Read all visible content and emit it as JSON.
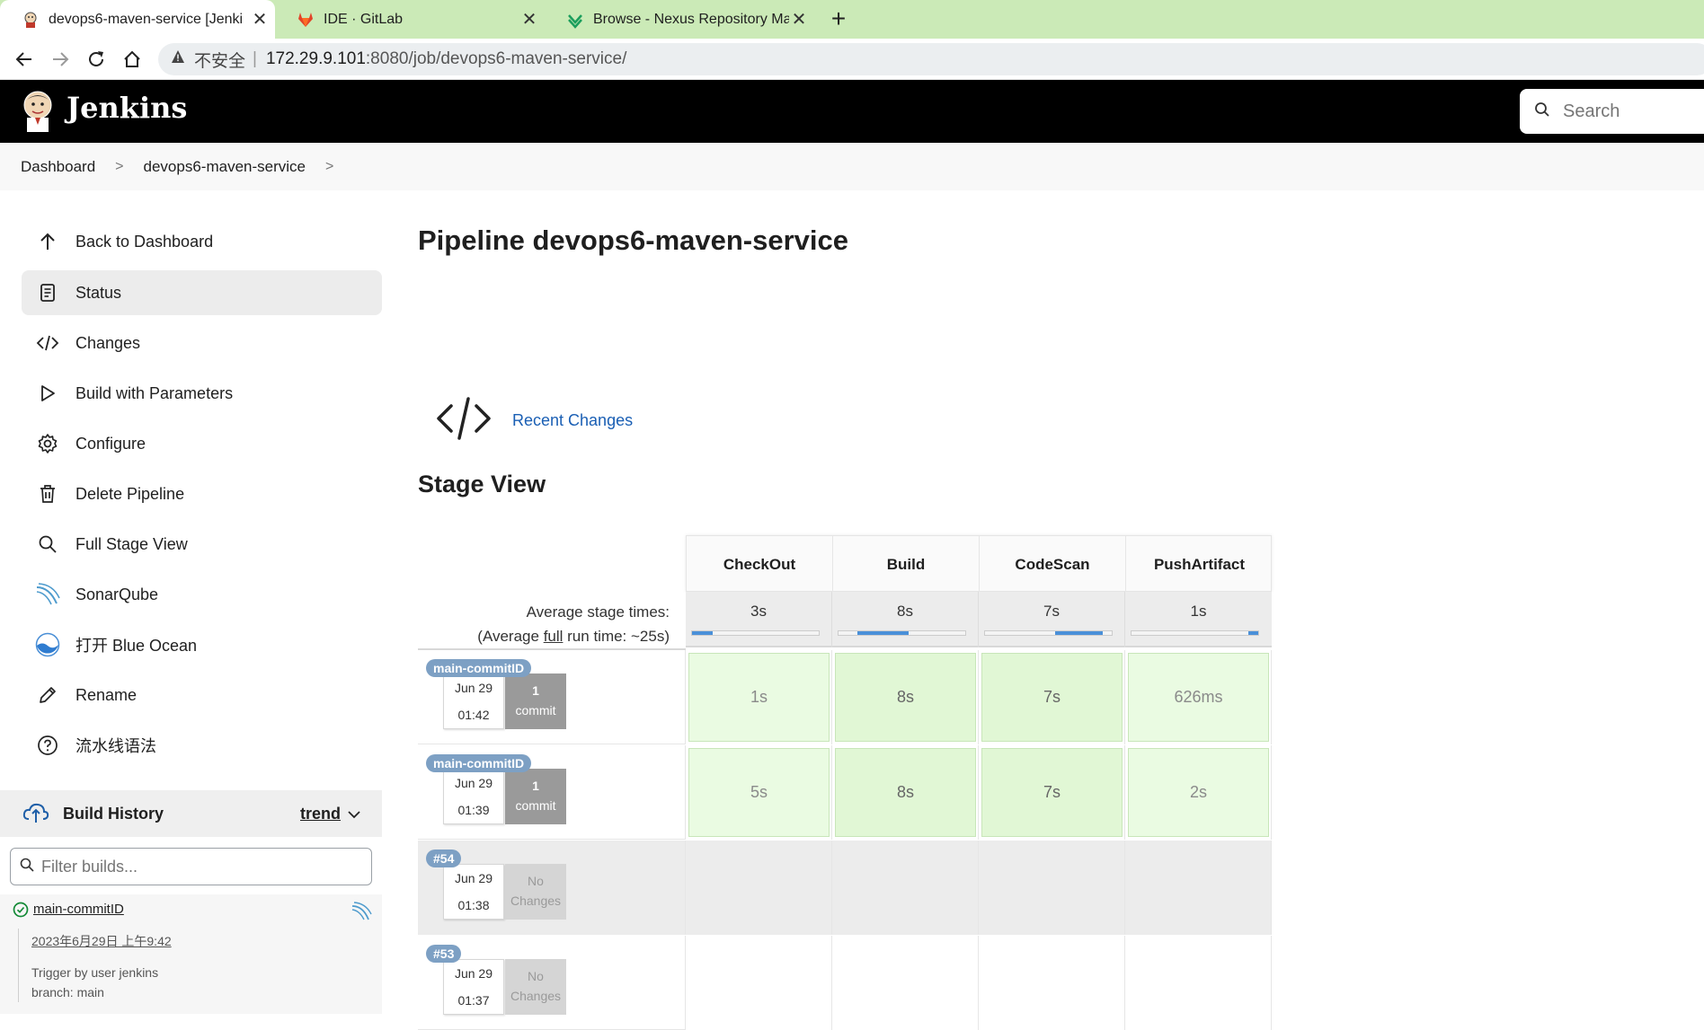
{
  "browser": {
    "tabs": [
      {
        "title": "devops6-maven-service [Jenki",
        "favicon": "jenkins-icon",
        "active": true
      },
      {
        "title": "IDE · GitLab",
        "favicon": "gitlab-icon",
        "active": false
      },
      {
        "title": "Browse - Nexus Repository Ma",
        "favicon": "nexus-icon",
        "active": false
      }
    ],
    "new_tab": "+",
    "address": {
      "insecure_label": "不安全",
      "separator": "|",
      "host": "172.29.9.101",
      "path": ":8080/job/devops6-maven-service/"
    }
  },
  "header": {
    "app_name": "Jenkins",
    "search_placeholder": "Search"
  },
  "breadcrumb": [
    "Dashboard",
    "devops6-maven-service"
  ],
  "sidebar": {
    "items": [
      {
        "label": "Back to Dashboard",
        "icon": "arrow-up-icon"
      },
      {
        "label": "Status",
        "icon": "document-icon",
        "active": true
      },
      {
        "label": "Changes",
        "icon": "code-icon"
      },
      {
        "label": "Build with Parameters",
        "icon": "play-icon"
      },
      {
        "label": "Configure",
        "icon": "gear-icon"
      },
      {
        "label": "Delete Pipeline",
        "icon": "trash-icon"
      },
      {
        "label": "Full Stage View",
        "icon": "search-icon"
      },
      {
        "label": "SonarQube",
        "icon": "sonarqube-icon"
      },
      {
        "label": "打开 Blue Ocean",
        "icon": "blue-ocean-icon"
      },
      {
        "label": "Rename",
        "icon": "pencil-icon"
      },
      {
        "label": "流水线语法",
        "icon": "help-icon"
      }
    ],
    "build_history": {
      "title": "Build History",
      "trend_label": "trend",
      "filter_placeholder": "Filter builds...",
      "latest": {
        "name": "main-commitID",
        "date": "2023年6月29日 上午9:42",
        "trigger": "Trigger by user jenkins",
        "branch": "branch: main"
      }
    }
  },
  "main": {
    "title": "Pipeline devops6-maven-service",
    "recent_changes": "Recent Changes",
    "stage_view_title": "Stage View"
  },
  "stage_view": {
    "stages": [
      "CheckOut",
      "Build",
      "CodeScan",
      "PushArtifact"
    ],
    "avg_label_1": "Average stage times:",
    "avg_label_2_pre": "(Average ",
    "avg_label_2_link": "full",
    "avg_label_2_post": " run time: ~25s)",
    "averages": [
      "3s",
      "8s",
      "7s",
      "1s"
    ],
    "avg_bar_fractions": [
      {
        "start": 0.0,
        "end": 0.16
      },
      {
        "start": 0.15,
        "end": 0.55
      },
      {
        "start": 0.55,
        "end": 0.93
      },
      {
        "start": 0.92,
        "end": 1.0
      }
    ],
    "runs": [
      {
        "badge": "main-commitID",
        "date": "Jun 29",
        "time": "01:42",
        "changes_count": "1",
        "changes_label": "commit",
        "has_changes": true,
        "durations": [
          "1s",
          "8s",
          "7s",
          "626ms"
        ],
        "grey": false
      },
      {
        "badge": "main-commitID",
        "date": "Jun 29",
        "time": "01:39",
        "changes_count": "1",
        "changes_label": "commit",
        "has_changes": true,
        "durations": [
          "5s",
          "8s",
          "7s",
          "2s"
        ],
        "grey": false
      },
      {
        "badge": "#54",
        "date": "Jun 29",
        "time": "01:38",
        "changes_count": "No",
        "changes_label": "Changes",
        "has_changes": false,
        "durations": [],
        "grey": true
      },
      {
        "badge": "#53",
        "date": "Jun 29",
        "time": "01:37",
        "changes_count": "No",
        "changes_label": "Changes",
        "has_changes": false,
        "durations": [],
        "grey": false
      }
    ]
  },
  "colors": {
    "tabstrip": "#cbeab7",
    "success_cell": "#e1f7d5",
    "badge": "#7da0c4",
    "link": "#1a5fb4"
  }
}
